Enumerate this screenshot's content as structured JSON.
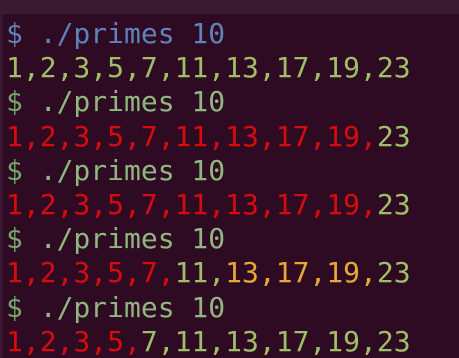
{
  "terminal": {
    "lines": [
      {
        "kind": "prompt",
        "symbol": "$",
        "command": " ./primes 10"
      },
      {
        "kind": "output",
        "segments": [
          {
            "text": "1,2,3,5,7,11,13,17,19,23",
            "color": "green"
          }
        ]
      },
      {
        "kind": "prompt",
        "symbol": "$",
        "command": " ./primes 10"
      },
      {
        "kind": "output",
        "segments": [
          {
            "text": "1,2,3,5,7,11,13,17,19,",
            "color": "red"
          },
          {
            "text": "23",
            "color": "green"
          }
        ]
      },
      {
        "kind": "prompt",
        "symbol": "$",
        "command": " ./primes 10"
      },
      {
        "kind": "output",
        "segments": [
          {
            "text": "1,2,3,5,7,11,13,17,19,",
            "color": "red"
          },
          {
            "text": "23",
            "color": "green"
          }
        ]
      },
      {
        "kind": "prompt",
        "symbol": "$",
        "command": " ./primes 10"
      },
      {
        "kind": "output",
        "segments": [
          {
            "text": "1,2,3,5,7,",
            "color": "red"
          },
          {
            "text": "11,",
            "color": "green"
          },
          {
            "text": "13,17,19,",
            "color": "orange"
          },
          {
            "text": "23",
            "color": "green"
          }
        ]
      },
      {
        "kind": "prompt",
        "symbol": "$",
        "command": " ./primes 10"
      },
      {
        "kind": "output",
        "segments": [
          {
            "text": "1,2,3,5,",
            "color": "red"
          },
          {
            "text": "7,11,13,17,19,23",
            "color": "green"
          }
        ]
      }
    ]
  },
  "colors": {
    "background": "#2e0b23",
    "prompt_first": "#5f83b8",
    "prompt": "#74a86a",
    "green": "#9fbf66",
    "red": "#d60c0c",
    "orange": "#e6a935"
  }
}
